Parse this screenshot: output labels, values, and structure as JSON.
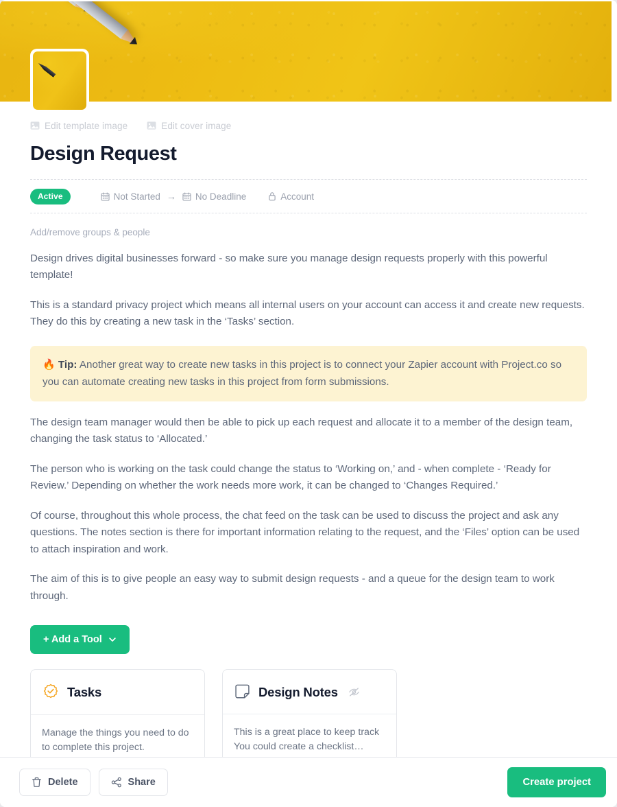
{
  "cover": {
    "alt": "yellow background with two pencils",
    "background_color": "#edbb12"
  },
  "header": {
    "edit_template_image": "Edit template image",
    "edit_cover_image": "Edit cover image",
    "title": "Design Request"
  },
  "meta": {
    "status": "Active",
    "start": "Not Started",
    "arrow": "→",
    "deadline": "No Deadline",
    "privacy": "Account",
    "groups_people": "Add/remove groups & people",
    "status_color": "#19bd7f"
  },
  "body": {
    "p1": "Design drives digital businesses forward - so make sure you manage design requests properly with this powerful template!",
    "p2": "This is a standard privacy project which means all internal users on your account can access it and create new requests. They do this by creating a new task in the ‘Tasks’ section.",
    "tip_emoji": "🔥",
    "tip_label": "Tip:",
    "tip_text": " Another great way to create new tasks in this project is to connect your Zapier account with Project.co so you can automate creating new tasks in this project from form submissions.",
    "p3": "The design team manager would then be able to pick up each request and allocate it to a member of the design team, changing the task status to ‘Allocated.’",
    "p4": "The person who is working on the task could change the status to ‘Working on,’ and - when complete - ‘Ready for Review.’ Depending on whether the work needs more work, it can be changed to ‘Changes Required.’",
    "p5": "Of course, throughout this whole process, the chat feed on the task can be used to discuss the project and ask any questions. The notes section is there for important information relating to the request, and the ‘Files’ option can be used to attach inspiration and work.",
    "p6": "The aim of this is to give people an easy way to submit design requests - and a queue for the design team to work through."
  },
  "toolbar": {
    "add_tool_label": "+ Add a Tool"
  },
  "tools": [
    {
      "icon": "tasks-badge-icon",
      "title": "Tasks",
      "description": "Manage the things you need to do to complete this project.",
      "hidden": false,
      "icon_color": "#f5a623"
    },
    {
      "icon": "note-icon",
      "title": "Design Notes",
      "description": "This is a great place to keep track You could create a checklist…",
      "hidden": true,
      "icon_color": "#6b7484"
    }
  ],
  "footer": {
    "delete_label": "Delete",
    "share_label": "Share",
    "create_label": "Create project",
    "primary_color": "#19bd7f"
  }
}
